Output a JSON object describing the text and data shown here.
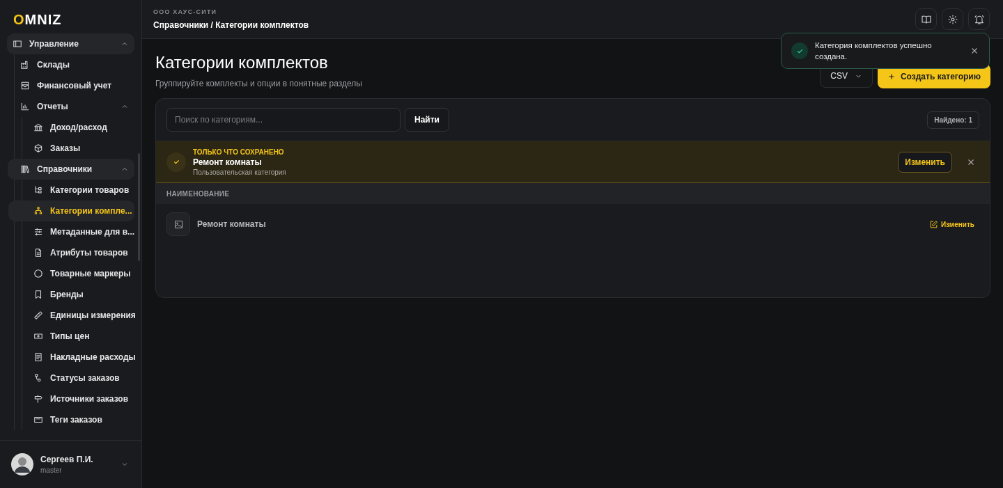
{
  "sidebar": {
    "logo": "OMNIZ",
    "nav": [
      {
        "label": "Управление",
        "expanded": true,
        "selected": false,
        "children": [
          {
            "label": "Склады",
            "selected": false
          },
          {
            "label": "Финансовый учет",
            "selected": false
          },
          {
            "label": "Отчеты",
            "expanded": true,
            "selected": false,
            "children": [
              {
                "label": "Доход/расход",
                "selected": false
              },
              {
                "label": "Заказы",
                "selected": false
              }
            ]
          },
          {
            "label": "Справочники",
            "expanded": true,
            "selected": false,
            "children": [
              {
                "label": "Категории товаров",
                "selected": false
              },
              {
                "label": "Категории компле...",
                "selected": true
              },
              {
                "label": "Метаданные для в...",
                "selected": false
              },
              {
                "label": "Атрибуты товаров",
                "selected": false
              },
              {
                "label": "Товарные маркеры",
                "selected": false
              },
              {
                "label": "Бренды",
                "selected": false
              },
              {
                "label": "Единицы измерения",
                "selected": false
              },
              {
                "label": "Типы цен",
                "selected": false
              },
              {
                "label": "Накладные расходы",
                "selected": false
              },
              {
                "label": "Статусы заказов",
                "selected": false
              },
              {
                "label": "Источники заказов",
                "selected": false
              },
              {
                "label": "Теги заказов",
                "selected": false
              }
            ]
          }
        ]
      }
    ],
    "user": {
      "name": "Сергеев П.И.",
      "role": "master"
    }
  },
  "header": {
    "organization": "ООО ХАУС-СИТИ",
    "breadcrumb": "Справочники / Категории комплектов"
  },
  "toast": {
    "message": "Категория комплектов успешно создана."
  },
  "page": {
    "title": "Категории комплектов",
    "subtitle": "Группируйте комплекты и опции в понятные разделы",
    "export_button": "CSV",
    "create_button": "Создать категорию"
  },
  "search": {
    "placeholder": "Поиск по категориям...",
    "button": "Найти",
    "found": "Найдено: 1"
  },
  "banner": {
    "label": "ТОЛЬКО ЧТО СОХРАНЕНО",
    "name": "Ремонт комнаты",
    "description": "Пользовательская категория",
    "edit_button": "Изменить"
  },
  "table": {
    "columns": [
      "НАИМЕНОВАНИЕ"
    ],
    "rows": [
      {
        "name": "Ремонт комнаты",
        "action": "Изменить"
      }
    ]
  }
}
